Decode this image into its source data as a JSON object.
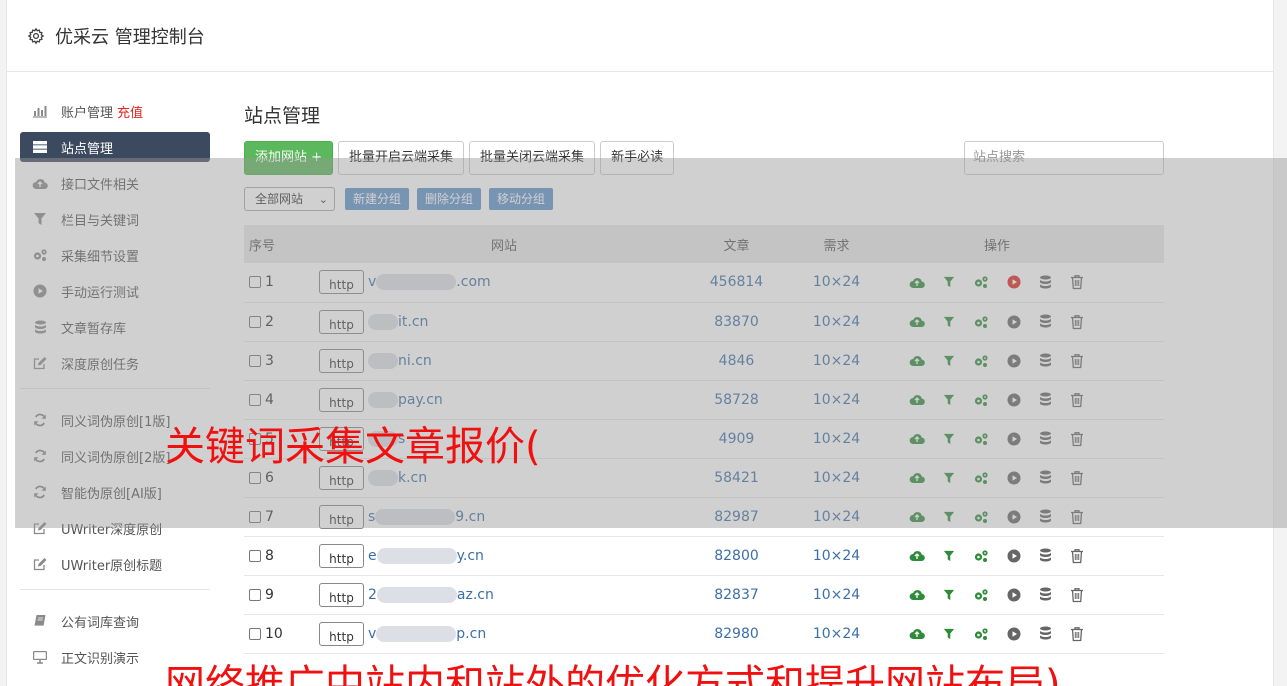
{
  "header": {
    "title": "优采云 管理控制台"
  },
  "sidebar": {
    "items": [
      {
        "label": "账户管理",
        "extra": "充值",
        "icon": "bar-chart-icon",
        "active": false
      },
      {
        "label": "站点管理",
        "extra": "",
        "icon": "server-icon",
        "active": true
      },
      {
        "label": "接口文件相关",
        "extra": "",
        "icon": "cloud-upload-icon",
        "active": false
      },
      {
        "label": "栏目与关键词",
        "extra": "",
        "icon": "filter-icon",
        "active": false
      },
      {
        "label": "采集细节设置",
        "extra": "",
        "icon": "cogs-icon",
        "active": false
      },
      {
        "label": "手动运行测试",
        "extra": "",
        "icon": "play-icon",
        "active": false
      },
      {
        "label": "文章暂存库",
        "extra": "",
        "icon": "database-icon",
        "active": false
      },
      {
        "label": "深度原创任务",
        "extra": "",
        "icon": "edit-icon",
        "active": false
      }
    ],
    "items2": [
      {
        "label": "同义词伪原创[1版]",
        "icon": "refresh-icon"
      },
      {
        "label": "同义词伪原创[2版]",
        "icon": "refresh-icon"
      },
      {
        "label": "智能伪原创[AI版]",
        "icon": "refresh-icon"
      },
      {
        "label": "UWriter深度原创",
        "icon": "edit-icon"
      },
      {
        "label": "UWriter原创标题",
        "icon": "edit-icon"
      }
    ],
    "items3": [
      {
        "label": "公有词库查询",
        "icon": "book-icon"
      },
      {
        "label": "正文识别演示",
        "icon": "monitor-icon"
      }
    ]
  },
  "main": {
    "title": "站点管理",
    "buttons": {
      "add": "添加网站 +",
      "batch_open": "批量开启云端采集",
      "batch_close": "批量关闭云端采集",
      "newbie": "新手必读"
    },
    "search_placeholder": "站点搜索",
    "group_select": "全部网站",
    "group_buttons": {
      "new": "新建分组",
      "delete": "删除分组",
      "move": "移动分组"
    },
    "columns": {
      "no": "序号",
      "site": "网站",
      "articles": "文章",
      "demand": "需求",
      "ops": "操作"
    },
    "rows": [
      {
        "no": "1",
        "site_visible": "v",
        "site_suffix": ".com",
        "articles": "456814",
        "demand": "10×24",
        "play_active": true
      },
      {
        "no": "2",
        "site_visible": "",
        "site_suffix": "it.cn",
        "articles": "83870",
        "demand": "10×24",
        "play_active": false
      },
      {
        "no": "3",
        "site_visible": "",
        "site_suffix": "ni.cn",
        "articles": "4846",
        "demand": "10×24",
        "play_active": false
      },
      {
        "no": "4",
        "site_visible": "",
        "site_suffix": "pay.cn",
        "articles": "58728",
        "demand": "10×24",
        "play_active": false
      },
      {
        "no": "5",
        "site_visible": "",
        "site_suffix": "s",
        "articles": "4909",
        "demand": "10×24",
        "play_active": false
      },
      {
        "no": "6",
        "site_visible": "",
        "site_suffix": "k.cn",
        "articles": "58421",
        "demand": "10×24",
        "play_active": false
      },
      {
        "no": "7",
        "site_visible": "s",
        "site_suffix": "9.cn",
        "articles": "82987",
        "demand": "10×24",
        "play_active": false
      },
      {
        "no": "8",
        "site_visible": "e",
        "site_suffix": "y.cn",
        "articles": "82800",
        "demand": "10×24",
        "play_active": false
      },
      {
        "no": "9",
        "site_visible": "2",
        "site_suffix": "az.cn",
        "articles": "82837",
        "demand": "10×24",
        "play_active": false
      },
      {
        "no": "10",
        "site_visible": "v",
        "site_suffix": "p.cn",
        "articles": "82980",
        "demand": "10×24",
        "play_active": false
      }
    ],
    "http_label": "http"
  },
  "watermark": {
    "line1": "关键词采集文章报价(",
    "line2": "网络推广中站内和站外的优化方式和提升网站布局)"
  },
  "colors": {
    "accent_green": "#5cb85c",
    "sidebar_active": "#3c4a5f",
    "link_blue": "#3b6fa8",
    "watermark_red": "#f01010",
    "play_red": "#e0261d"
  }
}
